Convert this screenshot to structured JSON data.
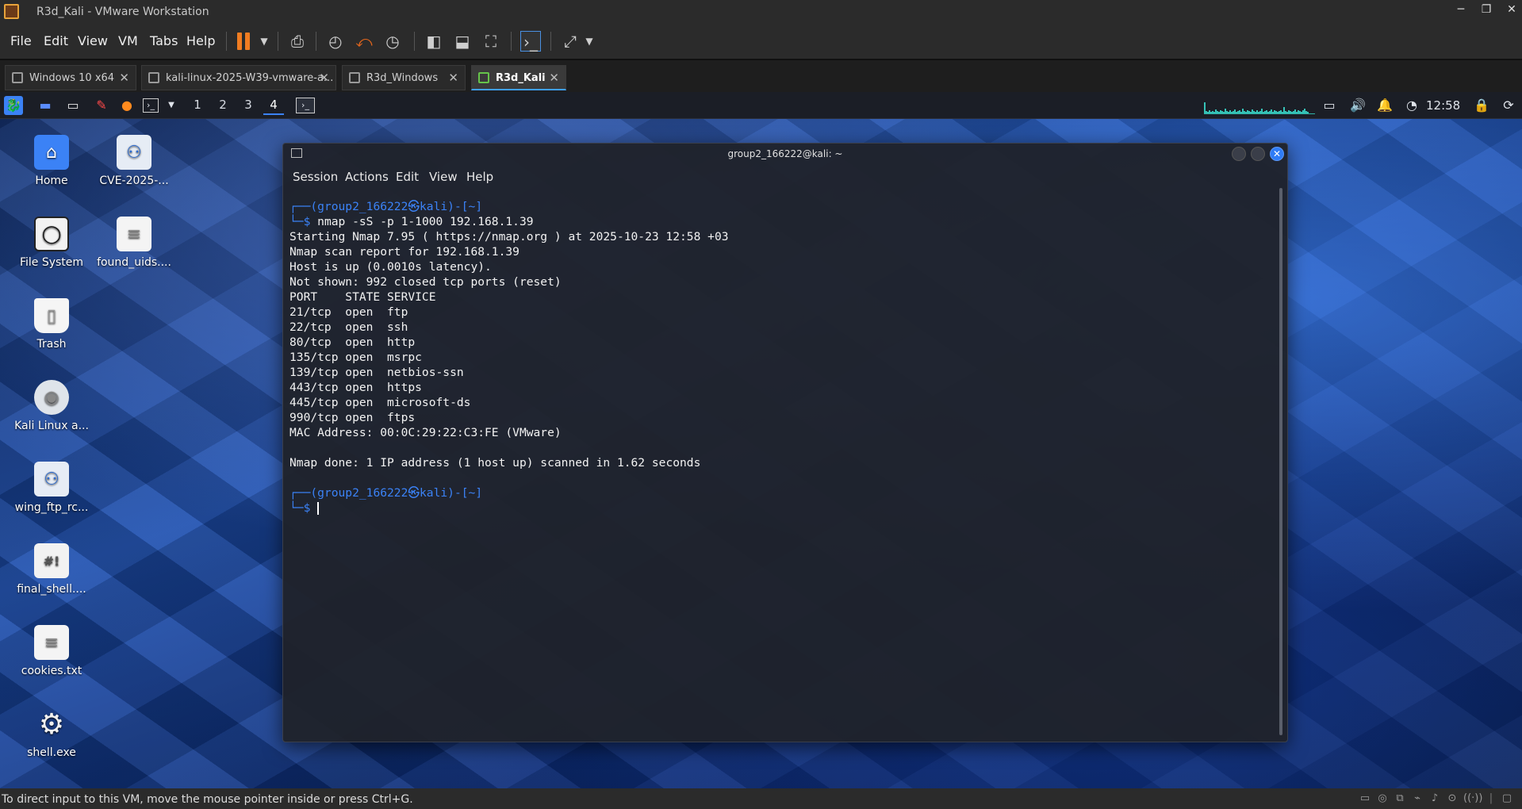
{
  "vmware": {
    "window_title": "R3d_Kali - VMware Workstation",
    "window_controls": [
      "─",
      "❐",
      "✕"
    ],
    "menus": [
      "File",
      "Edit",
      "View",
      "VM",
      "Tabs",
      "Help"
    ],
    "tabs": [
      {
        "label": "Windows 10 x64",
        "active": false
      },
      {
        "label": "kali-linux-2025-W39-vmware-a...",
        "active": false
      },
      {
        "label": "R3d_Windows",
        "active": false
      },
      {
        "label": "R3d_Kali",
        "active": true
      }
    ],
    "status_message": "To direct input to this VM, move the mouse pointer inside or press Ctrl+G."
  },
  "kali_panel": {
    "workspaces": [
      "1",
      "2",
      "3",
      "4"
    ],
    "active_workspace": "4",
    "clock": "12:58"
  },
  "desktop_icons": [
    {
      "label": "Home",
      "icon": "home-folder-icon"
    },
    {
      "label": "CVE-2025-...",
      "icon": "python-file-icon"
    },
    {
      "label": "File System",
      "icon": "drive-icon"
    },
    {
      "label": "found_uids....",
      "icon": "text-file-icon"
    },
    {
      "label": "Trash",
      "icon": "trash-icon"
    },
    {
      "label": "Kali Linux a...",
      "icon": "disc-icon"
    },
    {
      "label": "wing_ftp_rc...",
      "icon": "python-file-icon"
    },
    {
      "label": "final_shell....",
      "icon": "script-file-icon"
    },
    {
      "label": "cookies.txt",
      "icon": "text-file-icon"
    },
    {
      "label": "shell.exe",
      "icon": "gear-file-icon"
    }
  ],
  "terminal": {
    "title": "group2_166222@kali: ~",
    "menus": [
      "Session",
      "Actions",
      "Edit",
      "View",
      "Help"
    ],
    "prompt_user": "group2_166222",
    "prompt_host": "kali",
    "prompt_dir": "~",
    "command": "nmap -sS -p 1-1000 192.168.1.39",
    "output": [
      "Starting Nmap 7.95 ( https://nmap.org ) at 2025-10-23 12:58 +03",
      "Nmap scan report for 192.168.1.39",
      "Host is up (0.0010s latency).",
      "Not shown: 992 closed tcp ports (reset)",
      "PORT    STATE SERVICE",
      "21/tcp  open  ftp",
      "22/tcp  open  ssh",
      "80/tcp  open  http",
      "135/tcp open  msrpc",
      "139/tcp open  netbios-ssn",
      "443/tcp open  https",
      "445/tcp open  microsoft-ds",
      "990/tcp open  ftps",
      "MAC Address: 00:0C:29:22:C3:FE (VMware)",
      "",
      "Nmap done: 1 IP address (1 host up) scanned in 1.62 seconds"
    ]
  }
}
